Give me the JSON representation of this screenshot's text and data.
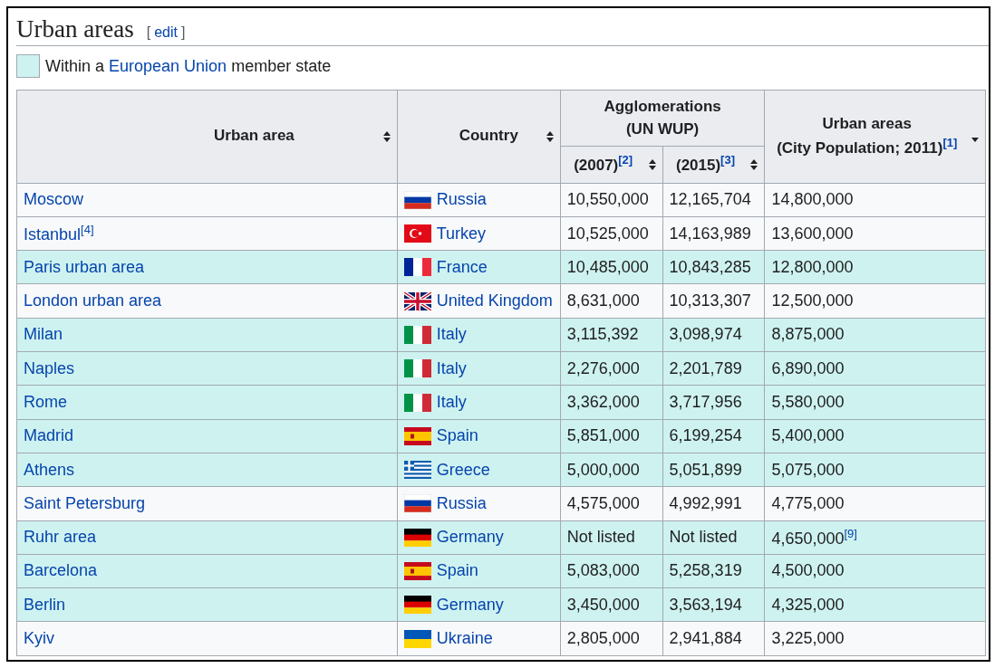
{
  "heading": {
    "title": "Urban areas",
    "edit_open": "[",
    "edit_label": "edit",
    "edit_close": "]"
  },
  "legend": {
    "before": "Within a",
    "link": "European Union",
    "after": "member state"
  },
  "table": {
    "columns": [
      {
        "label": [
          "Urban area"
        ],
        "sorted_descending": false
      },
      {
        "label": [
          "Country"
        ],
        "sorted_descending": false
      },
      {
        "label": [
          "Agglomerations",
          "(UN WUP)"
        ],
        "children": [
          {
            "label": [
              "(2007)$^{[2]}$"
            ],
            "sorted_descending": false
          },
          {
            "label": [
              "(2015)$^{[3]}$"
            ],
            "sorted_descending": false
          }
        ]
      },
      {
        "label": [
          "Urban areas",
          "(City Population; 2011)$^{[1]}$"
        ],
        "sorted_descending": true
      }
    ],
    "rows": [
      {
        "eu": false,
        "area": "Moscow",
        "kind": "ru",
        "country": "Russia",
        "y2007": "10,550,000",
        "y2015": "12,165,704",
        "y2011": "14,800,000"
      },
      {
        "eu": false,
        "area": "Istanbul$^{[4]}$",
        "kind": "tr",
        "country": "Turkey",
        "y2007": "10,525,000",
        "y2015": "14,163,989",
        "y2011": "13,600,000"
      },
      {
        "eu": true,
        "area": "Paris urban area",
        "kind": "fr",
        "country": "France",
        "y2007": "10,485,000",
        "y2015": "10,843,285",
        "y2011": "12,800,000"
      },
      {
        "eu": false,
        "area": "London urban area",
        "kind": "uk",
        "country": "United Kingdom",
        "y2007": "8,631,000",
        "y2015": "10,313,307",
        "y2011": "12,500,000"
      },
      {
        "eu": true,
        "area": "Milan",
        "kind": "it",
        "country": "Italy",
        "y2007": "3,115,392",
        "y2015": "3,098,974",
        "y2011": "8,875,000"
      },
      {
        "eu": true,
        "area": "Naples",
        "kind": "it",
        "country": "Italy",
        "y2007": "2,276,000",
        "y2015": "2,201,789",
        "y2011": "6,890,000"
      },
      {
        "eu": true,
        "area": "Rome",
        "kind": "it",
        "country": "Italy",
        "y2007": "3,362,000",
        "y2015": "3,717,956",
        "y2011": "5,580,000"
      },
      {
        "eu": true,
        "area": "Madrid",
        "kind": "es",
        "country": "Spain",
        "y2007": "5,851,000",
        "y2015": "6,199,254",
        "y2011": "5,400,000"
      },
      {
        "eu": true,
        "area": "Athens",
        "kind": "gr",
        "country": "Greece",
        "y2007": "5,000,000",
        "y2015": "5,051,899",
        "y2011": "5,075,000"
      },
      {
        "eu": false,
        "area": "Saint Petersburg",
        "kind": "ru",
        "country": "Russia",
        "y2007": "4,575,000",
        "y2015": "4,992,991",
        "y2011": "4,775,000"
      },
      {
        "eu": true,
        "area": "Ruhr area",
        "kind": "de",
        "country": "Germany",
        "y2007": "Not listed",
        "y2015": "Not listed",
        "y2011": "4,650,000$^{[9]}$"
      },
      {
        "eu": true,
        "area": "Barcelona",
        "kind": "es",
        "country": "Spain",
        "y2007": "5,083,000",
        "y2015": "5,258,319",
        "y2011": "4,500,000"
      },
      {
        "eu": true,
        "area": "Berlin",
        "kind": "de",
        "country": "Germany",
        "y2007": "3,450,000",
        "y2015": "3,563,194",
        "y2011": "4,325,000"
      },
      {
        "eu": false,
        "area": "Kyiv",
        "kind": "ua",
        "country": "Ukraine",
        "y2007": "2,805,000",
        "y2015": "2,941,884",
        "y2011": "3,225,000"
      }
    ]
  }
}
